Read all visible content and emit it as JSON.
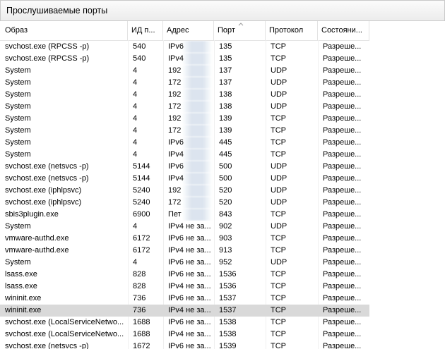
{
  "section": {
    "title": "Прослушиваемые порты"
  },
  "columns": {
    "image": "Образ",
    "pid": "ИД п...",
    "address": "Адрес",
    "port": "Порт",
    "protocol": "Протокол",
    "status": "Состояни..."
  },
  "rows": [
    {
      "image": "svchost.exe (RPCSS -p)",
      "pid": "540",
      "address": "IPv6",
      "port": "135",
      "protocol": "TCP",
      "status": "Разреше..."
    },
    {
      "image": "svchost.exe (RPCSS -p)",
      "pid": "540",
      "address": "IPv4",
      "port": "135",
      "protocol": "TCP",
      "status": "Разреше..."
    },
    {
      "image": "System",
      "pid": "4",
      "address": "192",
      "port": "137",
      "protocol": "UDP",
      "status": "Разреше..."
    },
    {
      "image": "System",
      "pid": "4",
      "address": "172",
      "port": "137",
      "protocol": "UDP",
      "status": "Разреше..."
    },
    {
      "image": "System",
      "pid": "4",
      "address": "192",
      "port": "138",
      "protocol": "UDP",
      "status": "Разреше..."
    },
    {
      "image": "System",
      "pid": "4",
      "address": "172",
      "port": "138",
      "protocol": "UDP",
      "status": "Разреше..."
    },
    {
      "image": "System",
      "pid": "4",
      "address": "192",
      "port": "139",
      "protocol": "TCP",
      "status": "Разреше..."
    },
    {
      "image": "System",
      "pid": "4",
      "address": "172",
      "port": "139",
      "protocol": "TCP",
      "status": "Разреше..."
    },
    {
      "image": "System",
      "pid": "4",
      "address": "IPv6",
      "port": "445",
      "protocol": "TCP",
      "status": "Разреше..."
    },
    {
      "image": "System",
      "pid": "4",
      "address": "IPv4",
      "port": "445",
      "protocol": "TCP",
      "status": "Разреше..."
    },
    {
      "image": "svchost.exe (netsvcs -p)",
      "pid": "5144",
      "address": "IPv6",
      "port": "500",
      "protocol": "UDP",
      "status": "Разреше..."
    },
    {
      "image": "svchost.exe (netsvcs -p)",
      "pid": "5144",
      "address": "IPv4",
      "port": "500",
      "protocol": "UDP",
      "status": "Разреше..."
    },
    {
      "image": "svchost.exe (iphlpsvc)",
      "pid": "5240",
      "address": "192",
      "port": "520",
      "protocol": "UDP",
      "status": "Разреше..."
    },
    {
      "image": "svchost.exe (iphlpsvc)",
      "pid": "5240",
      "address": "172",
      "port": "520",
      "protocol": "UDP",
      "status": "Разреше..."
    },
    {
      "image": "sbis3plugin.exe",
      "pid": "6900",
      "address": "Пет",
      "port": "843",
      "protocol": "TCP",
      "status": "Разреше..."
    },
    {
      "image": "System",
      "pid": "4",
      "address": "IPv4 не за...",
      "port": "902",
      "protocol": "UDP",
      "status": "Разреше..."
    },
    {
      "image": "vmware-authd.exe",
      "pid": "6172",
      "address": "IPv6 не за...",
      "port": "903",
      "protocol": "TCP",
      "status": "Разреше..."
    },
    {
      "image": "vmware-authd.exe",
      "pid": "6172",
      "address": "IPv4 не за...",
      "port": "913",
      "protocol": "TCP",
      "status": "Разреше..."
    },
    {
      "image": "System",
      "pid": "4",
      "address": "IPv6 не за...",
      "port": "952",
      "protocol": "UDP",
      "status": "Разреше..."
    },
    {
      "image": "lsass.exe",
      "pid": "828",
      "address": "IPv6 не за...",
      "port": "1536",
      "protocol": "TCP",
      "status": "Разреше..."
    },
    {
      "image": "lsass.exe",
      "pid": "828",
      "address": "IPv4 не за...",
      "port": "1536",
      "protocol": "TCP",
      "status": "Разреше..."
    },
    {
      "image": "wininit.exe",
      "pid": "736",
      "address": "IPv6 не за...",
      "port": "1537",
      "protocol": "TCP",
      "status": "Разреше..."
    },
    {
      "image": "wininit.exe",
      "pid": "736",
      "address": "IPv4 не за...",
      "port": "1537",
      "protocol": "TCP",
      "status": "Разреше...",
      "selected": true
    },
    {
      "image": "svchost.exe (LocalServiceNetwo...",
      "pid": "1688",
      "address": "IPv6 не за...",
      "port": "1538",
      "protocol": "TCP",
      "status": "Разреше..."
    },
    {
      "image": "svchost.exe (LocalServiceNetwo...",
      "pid": "1688",
      "address": "IPv4 не за...",
      "port": "1538",
      "protocol": "TCP",
      "status": "Разреше..."
    },
    {
      "image": "svchost.exe (netsvcs -p)",
      "pid": "1672",
      "address": "IPv6 не за...",
      "port": "1539",
      "protocol": "TCP",
      "status": "Разреше..."
    }
  ],
  "sort": {
    "column": "port",
    "direction": "ascending",
    "indicator_icon": "chevron-up-icon"
  }
}
